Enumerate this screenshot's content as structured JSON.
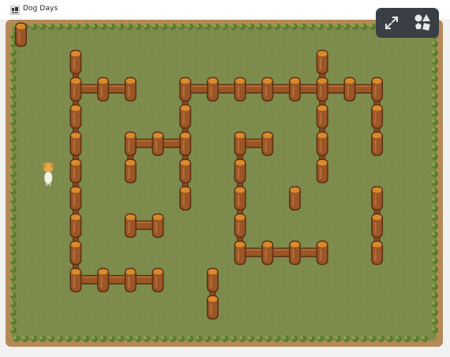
{
  "window": {
    "title": "Dog Days"
  },
  "icons": {
    "app": "dog-app-icon",
    "fullscreen": "expand-arrows-icon",
    "shapes": "shapes-icon"
  },
  "colors": {
    "grass": "#7d8c4d",
    "dirt_border": "#b38a55",
    "fence_wood": "#9a5626",
    "fence_dark": "#5b2f14",
    "post_top": "#d98a2c",
    "overlay_bg": "#3a3f45"
  },
  "game": {
    "player": "dog",
    "tile_grid": {
      "cols": 15,
      "rows": 11
    },
    "fence_posts": [
      [
        0,
        0
      ],
      [
        2,
        1
      ],
      [
        11,
        1
      ],
      [
        2,
        2
      ],
      [
        3,
        2
      ],
      [
        4,
        2
      ],
      [
        6,
        2
      ],
      [
        7,
        2
      ],
      [
        8,
        2
      ],
      [
        9,
        2
      ],
      [
        10,
        2
      ],
      [
        11,
        2
      ],
      [
        12,
        2
      ],
      [
        13,
        2
      ],
      [
        2,
        3
      ],
      [
        6,
        3
      ],
      [
        11,
        3
      ],
      [
        13,
        3
      ],
      [
        2,
        4
      ],
      [
        4,
        4
      ],
      [
        5,
        4
      ],
      [
        6,
        4
      ],
      [
        8,
        4
      ],
      [
        9,
        4
      ],
      [
        11,
        4
      ],
      [
        13,
        4
      ],
      [
        2,
        5
      ],
      [
        4,
        5
      ],
      [
        6,
        5
      ],
      [
        8,
        5
      ],
      [
        11,
        5
      ],
      [
        2,
        6
      ],
      [
        6,
        6
      ],
      [
        8,
        6
      ],
      [
        10,
        6
      ],
      [
        13,
        6
      ],
      [
        2,
        7
      ],
      [
        4,
        7
      ],
      [
        5,
        7
      ],
      [
        8,
        7
      ],
      [
        13,
        7
      ],
      [
        2,
        8
      ],
      [
        8,
        8
      ],
      [
        9,
        8
      ],
      [
        10,
        8
      ],
      [
        11,
        8
      ],
      [
        13,
        8
      ],
      [
        2,
        9
      ],
      [
        3,
        9
      ],
      [
        4,
        9
      ],
      [
        5,
        9
      ],
      [
        7,
        9
      ],
      [
        7,
        10
      ]
    ],
    "dog_tile": [
      1,
      5
    ]
  }
}
